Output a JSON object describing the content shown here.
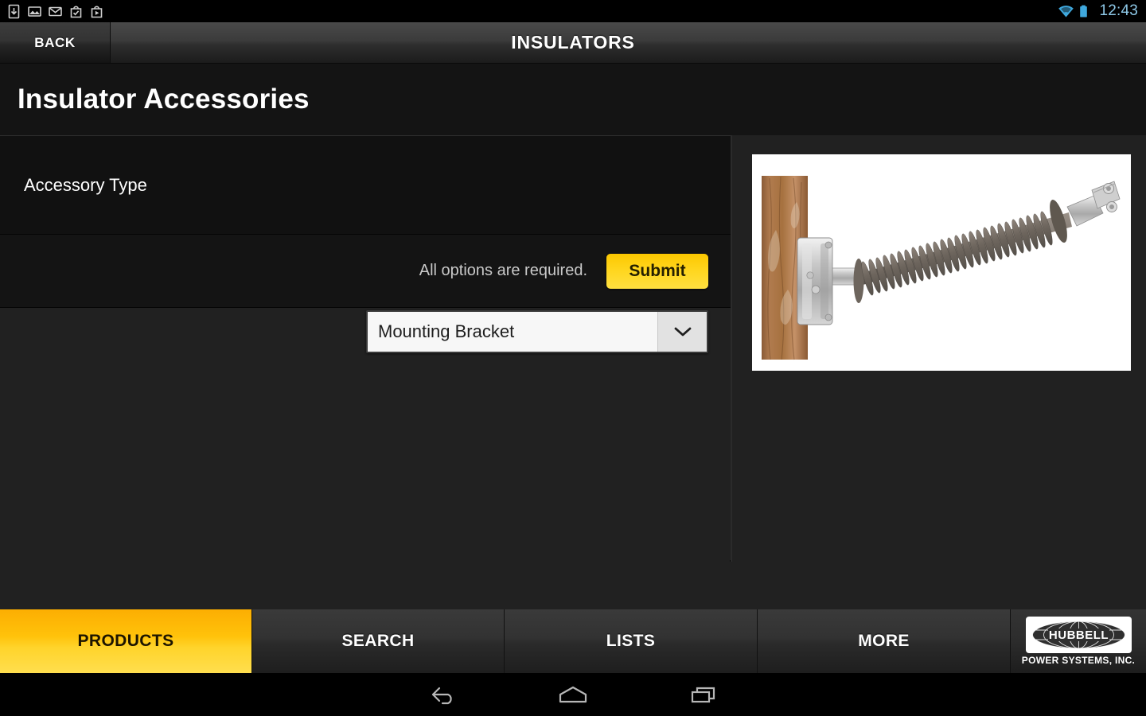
{
  "statusbar": {
    "icons": [
      "download-icon",
      "gallery-icon",
      "gmail-icon",
      "play-store-icon",
      "play-movies-icon"
    ],
    "wifi_icon": "wifi-icon",
    "battery_icon": "battery-icon",
    "clock": "12:43"
  },
  "titlebar": {
    "back_label": "BACK",
    "title": "INSULATORS"
  },
  "page": {
    "title": "Insulator Accessories"
  },
  "form": {
    "accessory_type_label": "Accessory Type",
    "accessory_type_value": "Mounting Bracket",
    "dropdown_icon": "chevron-down-icon",
    "required_note": "All options are required.",
    "submit_label": "Submit"
  },
  "product_image": {
    "alt": "Polymer line post insulator mounted with galvanized bracket on wooden utility pole"
  },
  "tabs": [
    {
      "label": "PRODUCTS",
      "active": true
    },
    {
      "label": "SEARCH",
      "active": false
    },
    {
      "label": "LISTS",
      "active": false
    },
    {
      "label": "MORE",
      "active": false
    }
  ],
  "logo": {
    "brand": "HUBBELL",
    "subtitle": "POWER SYSTEMS, INC."
  },
  "navbar": {
    "back_icon": "android-back-icon",
    "home_icon": "android-home-icon",
    "recents_icon": "android-recents-icon"
  },
  "colors": {
    "accent_yellow": "#FFC20A",
    "submit_yellow": "#FFD61F",
    "clock_blue": "#8EC9E8",
    "page_bg": "#212121",
    "row_bg": "#111111"
  }
}
